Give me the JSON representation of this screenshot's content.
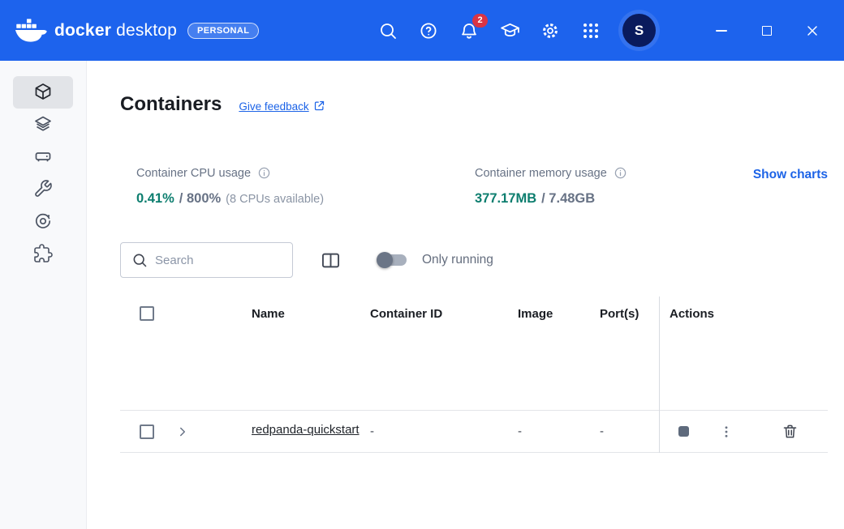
{
  "colors": {
    "header_blue": "#1D63ED",
    "link_blue": "#1C63E7",
    "stat_teal": "#0D7E6F",
    "running_green": "#2E9D63",
    "notification_red": "#D93444"
  },
  "header": {
    "brand_primary": "docker",
    "brand_secondary": "desktop",
    "plan_badge": "PERSONAL",
    "notification_count": "2",
    "avatar_initial": "S"
  },
  "sidebar": {
    "items": [
      "containers",
      "images",
      "volumes",
      "builds",
      "scout",
      "extensions"
    ],
    "selected": "containers"
  },
  "page": {
    "title": "Containers",
    "feedback_link": "Give feedback"
  },
  "stats": {
    "cpu": {
      "label": "Container CPU usage",
      "value": "0.41%",
      "total": "/ 800%",
      "note": "(8 CPUs available)"
    },
    "memory": {
      "label": "Container memory usage",
      "value": "377.17MB",
      "total": "/ 7.48GB"
    },
    "show_charts_label": "Show charts"
  },
  "controls": {
    "search_placeholder": "Search",
    "only_running_label": "Only running"
  },
  "table": {
    "columns": {
      "name": "Name",
      "container_id": "Container ID",
      "image": "Image",
      "ports": "Port(s)",
      "actions": "Actions"
    },
    "row": {
      "name": "redpanda-quickstart",
      "container_id": "-",
      "image": "-",
      "ports": "-",
      "status": "running"
    }
  }
}
